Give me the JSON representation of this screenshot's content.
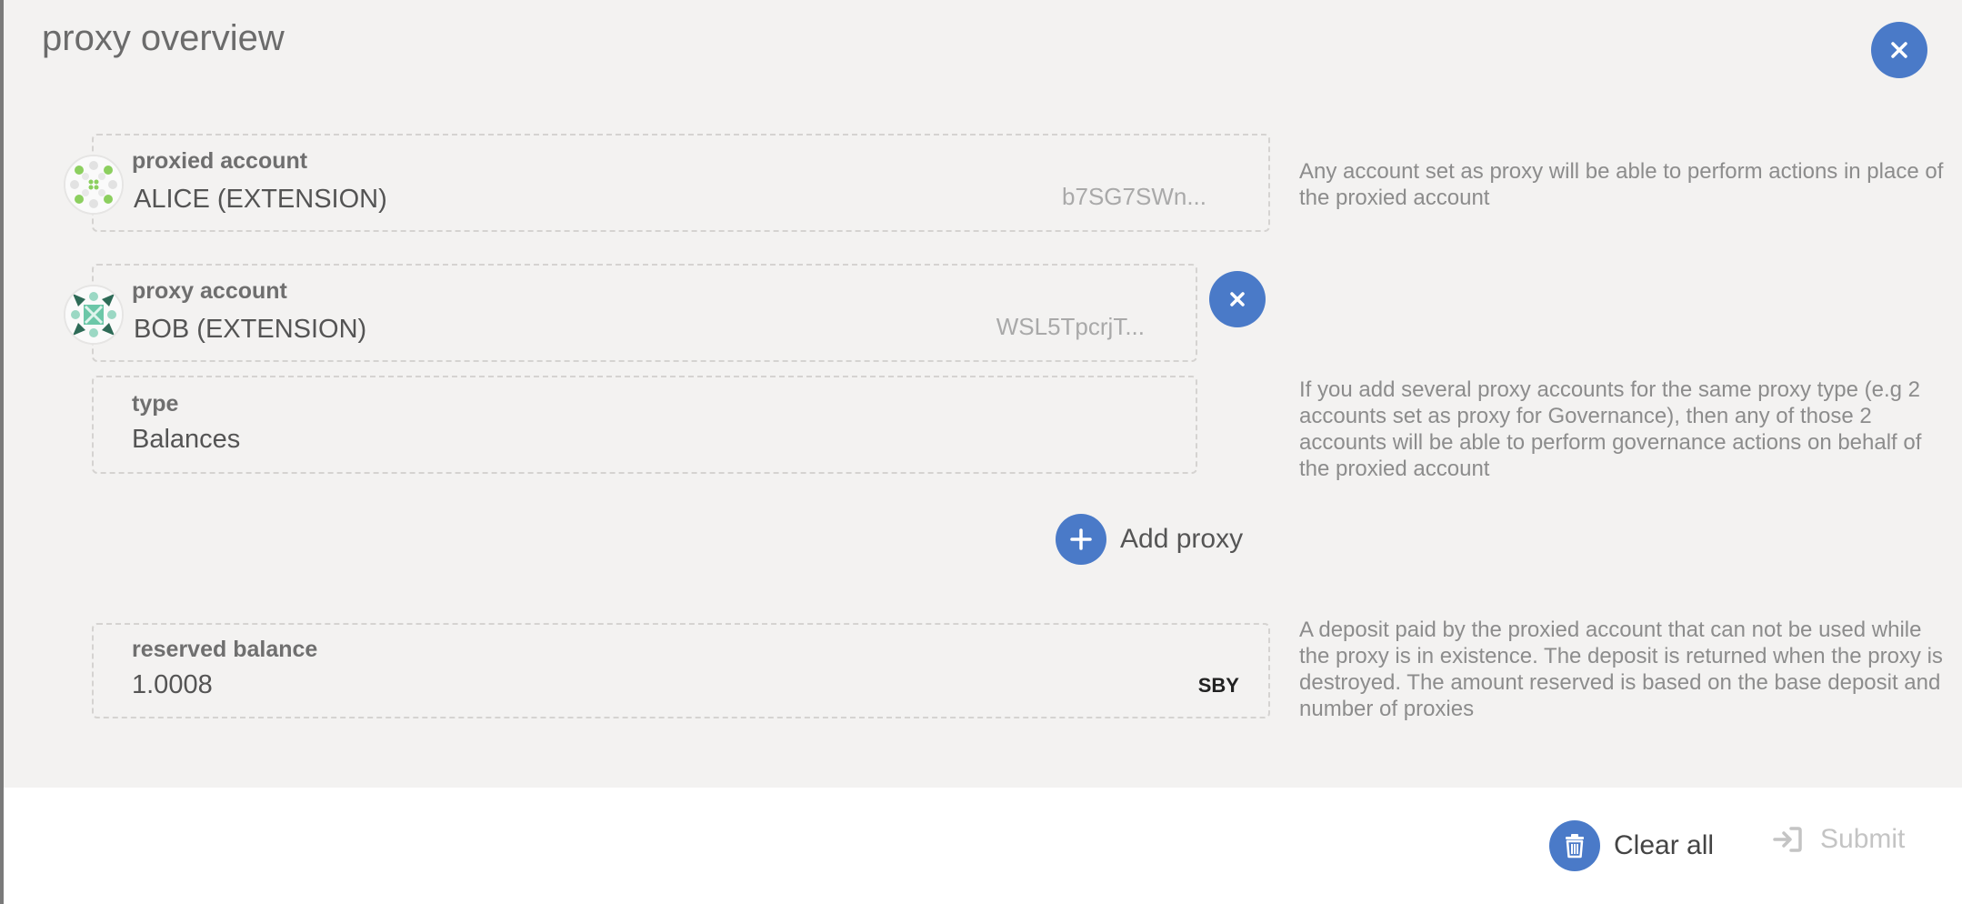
{
  "modal": {
    "title": "proxy overview"
  },
  "proxied": {
    "label": "proxied account",
    "name": "ALICE (EXTENSION)",
    "address": "b7SG7SWn...",
    "help": "Any account set as proxy will be able to perform actions in place of the proxied account"
  },
  "proxy": {
    "label": "proxy account",
    "name": "BOB (EXTENSION)",
    "address": "WSL5TpcrjT..."
  },
  "type": {
    "label": "type",
    "value": "Balances",
    "help": "If you add several proxy accounts for the same proxy type (e.g 2 accounts set as proxy for Governance), then any of those 2 accounts will be able to perform governance actions on behalf of the proxied account"
  },
  "add_proxy_label": "Add proxy",
  "reserved": {
    "label": "reserved balance",
    "value": "1.0008",
    "unit": "SBY",
    "help": "A deposit paid by the proxied account that can not be used while the proxy is in existence. The deposit is returned when the proxy is destroyed. The amount reserved is based on the base deposit and number of proxies"
  },
  "footer": {
    "clear_all_label": "Clear all",
    "submit_label": "Submit"
  },
  "colors": {
    "accent": "#4a7ac8",
    "background": "#f3f2f1"
  },
  "icons": [
    "close-icon",
    "plus-icon",
    "trash-icon",
    "sign-in-icon",
    "identicon"
  ]
}
